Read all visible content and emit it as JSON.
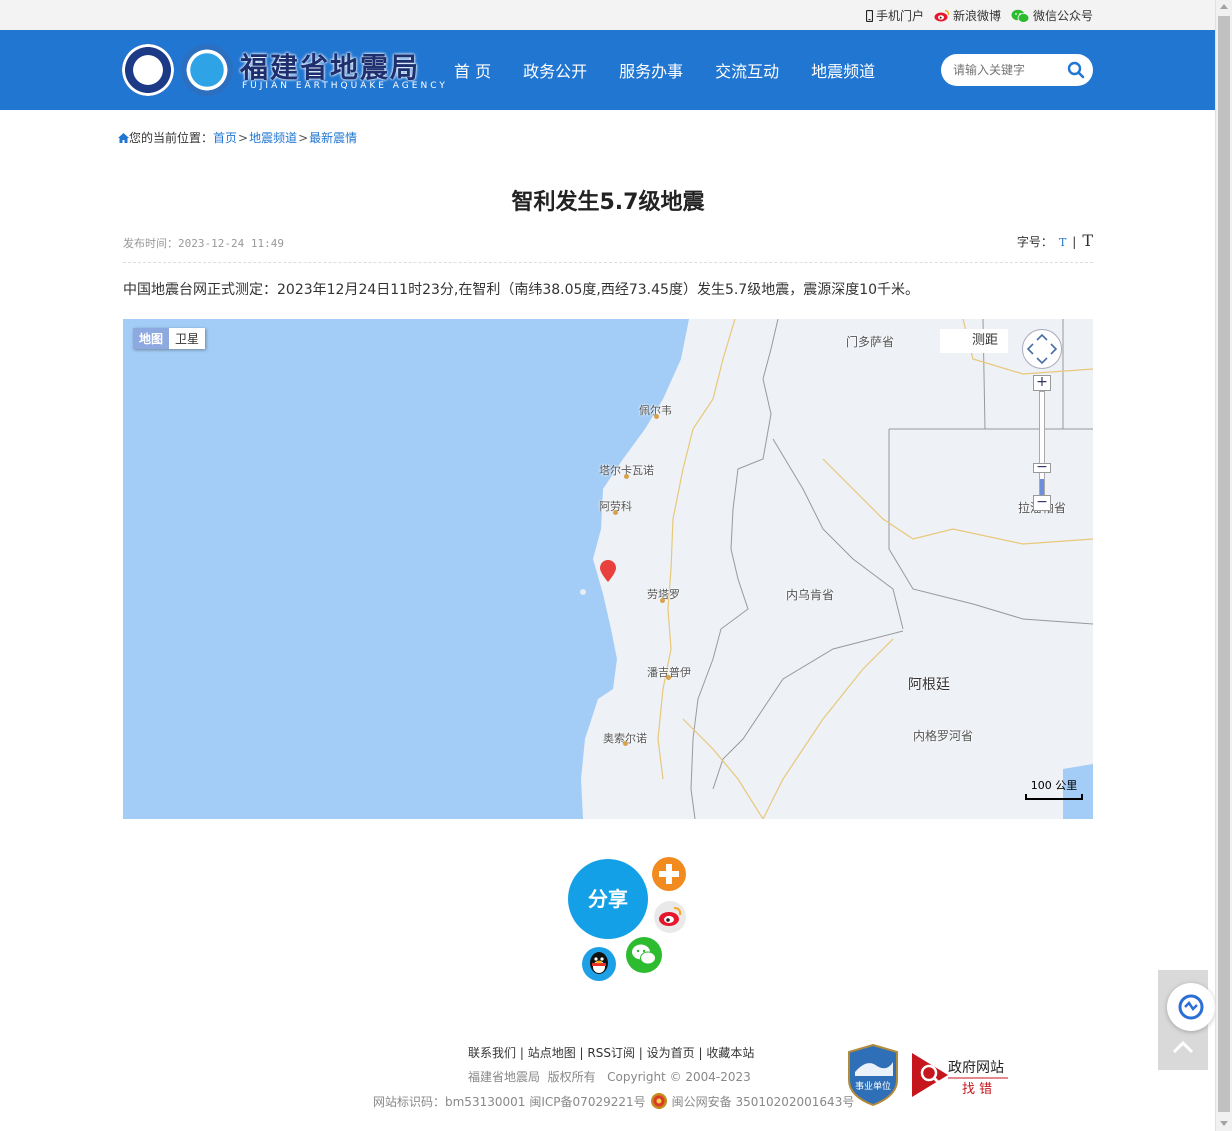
{
  "topbar": {
    "links": [
      {
        "label": "手机门户",
        "icon": "mobile-icon"
      },
      {
        "label": "新浪微博",
        "icon": "weibo-icon"
      },
      {
        "label": "微信公众号",
        "icon": "wechat-icon"
      }
    ]
  },
  "header": {
    "logo_title": "福建省地震局",
    "logo_subtitle": "FUJIAN EARTHQUAKE AGENCY",
    "nav": [
      "首 页",
      "政务公开",
      "服务办事",
      "交流互动",
      "地震频道"
    ],
    "search_placeholder": "请输入关键字",
    "accent_color": "#2176d2"
  },
  "breadcrumb": {
    "prefix": "您的当前位置：",
    "items": [
      "首页",
      "地震频道",
      "最新震情"
    ],
    "separator": ">"
  },
  "article": {
    "title": "智利发生5.7级地震",
    "publish_label": "发布时间：",
    "publish_time": "2023-12-24 11:49",
    "font_size_label": "字号：",
    "font_small": "T",
    "font_sep": "|",
    "font_big": "T",
    "body": "中国地震台网正式测定：2023年12月24日11时23分,在智利（南纬38.05度,西经73.45度）发生5.7级地震，震源深度10千米。"
  },
  "map": {
    "type_tabs": [
      "地图",
      "卫星"
    ],
    "active_tab": "地图",
    "measure_label": "测距",
    "scale_label": "100 公里",
    "labels": {
      "mendoza": "门多萨省",
      "pelluhue": "佩尔韦",
      "talcahuano": "塔尔卡瓦诺",
      "arauco": "阿劳科",
      "lautaro": "劳塔罗",
      "panguipulli": "潘吉普伊",
      "osorno": "奥索尔诺",
      "neuquen": "内乌肯省",
      "argentina": "阿根廷",
      "rionegro": "内格罗河省",
      "lapampa": "拉潘帕省"
    },
    "sea_color": "#a3cdf6",
    "land_color": "#eef1f6",
    "marker_color": "#e8403d"
  },
  "share": {
    "label": "分享",
    "icons": [
      "more-share-icon",
      "weibo-share-icon",
      "wechat-share-icon",
      "qq-share-icon"
    ]
  },
  "footer": {
    "links": [
      "联系我们",
      "站点地图",
      "RSS订阅",
      "设为首页",
      "收藏本站"
    ],
    "copyright_owner": "福建省地震局",
    "rights": "版权所有",
    "copyright": "Copyright © 2004-2023",
    "site_id": "网站标识码：bm53130001",
    "icp": "闽ICP备07029221号",
    "police": "闽公网安备 35010202001643号",
    "badge_text": "事业单位",
    "gov_error_title": "政府网站",
    "gov_error_sub": "找 错"
  }
}
